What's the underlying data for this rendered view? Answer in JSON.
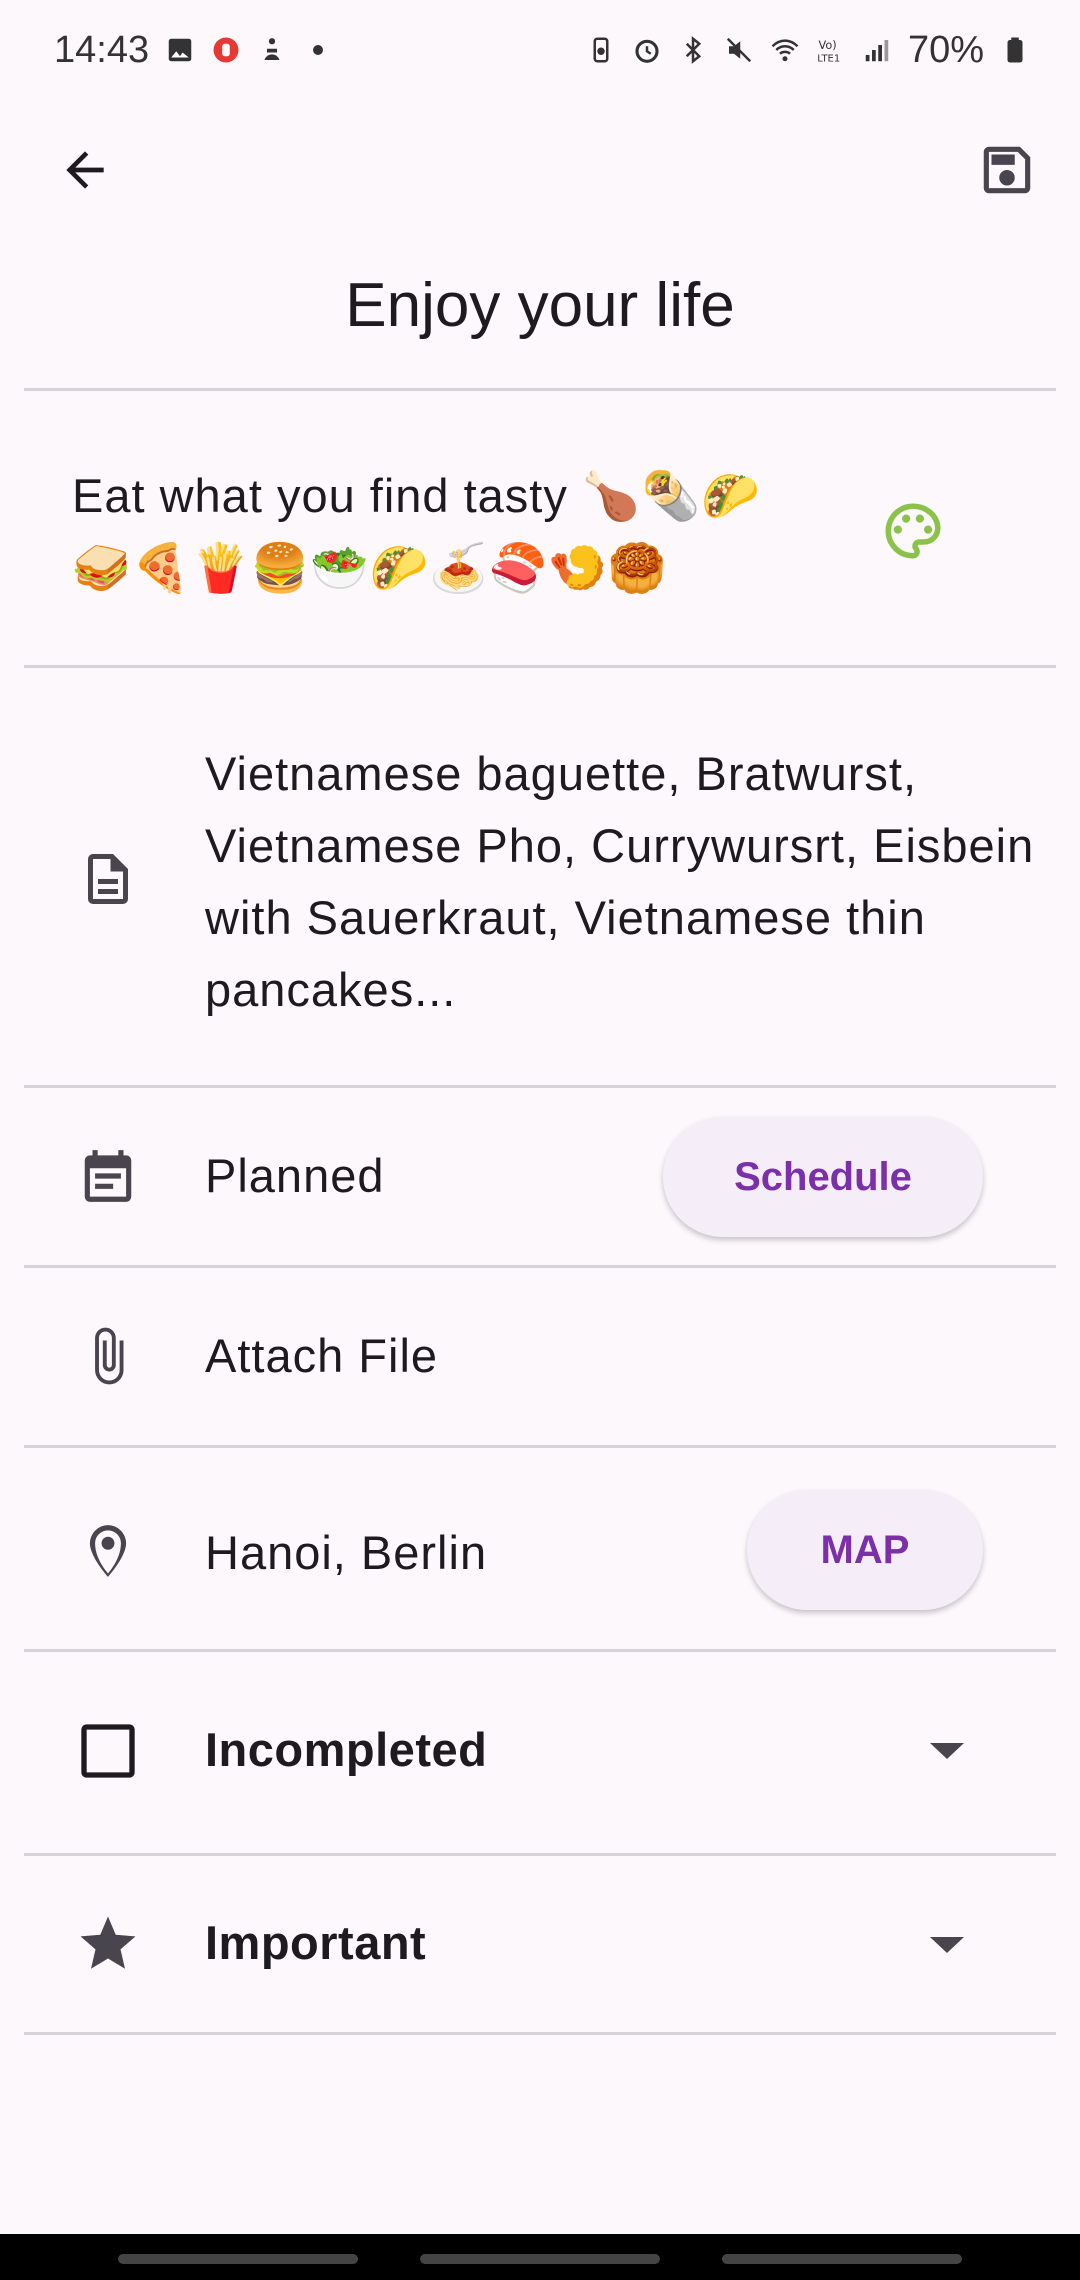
{
  "status_bar": {
    "time": "14:43",
    "battery": "70%",
    "left_icons": [
      "gallery-icon",
      "record-icon",
      "accessibility-icon",
      "dot-icon"
    ],
    "right_icons": [
      "battery-saver-icon",
      "alarm-icon",
      "bluetooth-icon",
      "mute-icon",
      "wifi-icon",
      "volte-icon",
      "signal-icon",
      "battery-icon"
    ]
  },
  "app_bar": {
    "back_icon": "arrow-back-icon",
    "save_icon": "save-icon"
  },
  "task": {
    "title": "Enjoy your life",
    "description": "Eat what you find tasty 🍗🌯🌮🥪🍕🍟🍔🥗🌮🍝🍣🍤🥮",
    "color_icon": "palette-icon",
    "notes": "Vietnamese baguette, Bratwurst, Vietnamese Pho, Currywursrt, Eisbein with Sauerkraut, Vietnamese thin pancakes..."
  },
  "rows": {
    "planned": {
      "label": "Planned",
      "button": "Schedule"
    },
    "attach": {
      "label": "Attach File"
    },
    "location": {
      "label": "Hanoi, Berlin",
      "button": "MAP"
    },
    "status": {
      "label": "Incompleted"
    },
    "priority": {
      "label": "Important"
    }
  },
  "colors": {
    "background": "#fdf8fc",
    "accent": "#7b2fa8",
    "palette_icon": "#8bc34a",
    "divider": "#d8d3d9"
  }
}
